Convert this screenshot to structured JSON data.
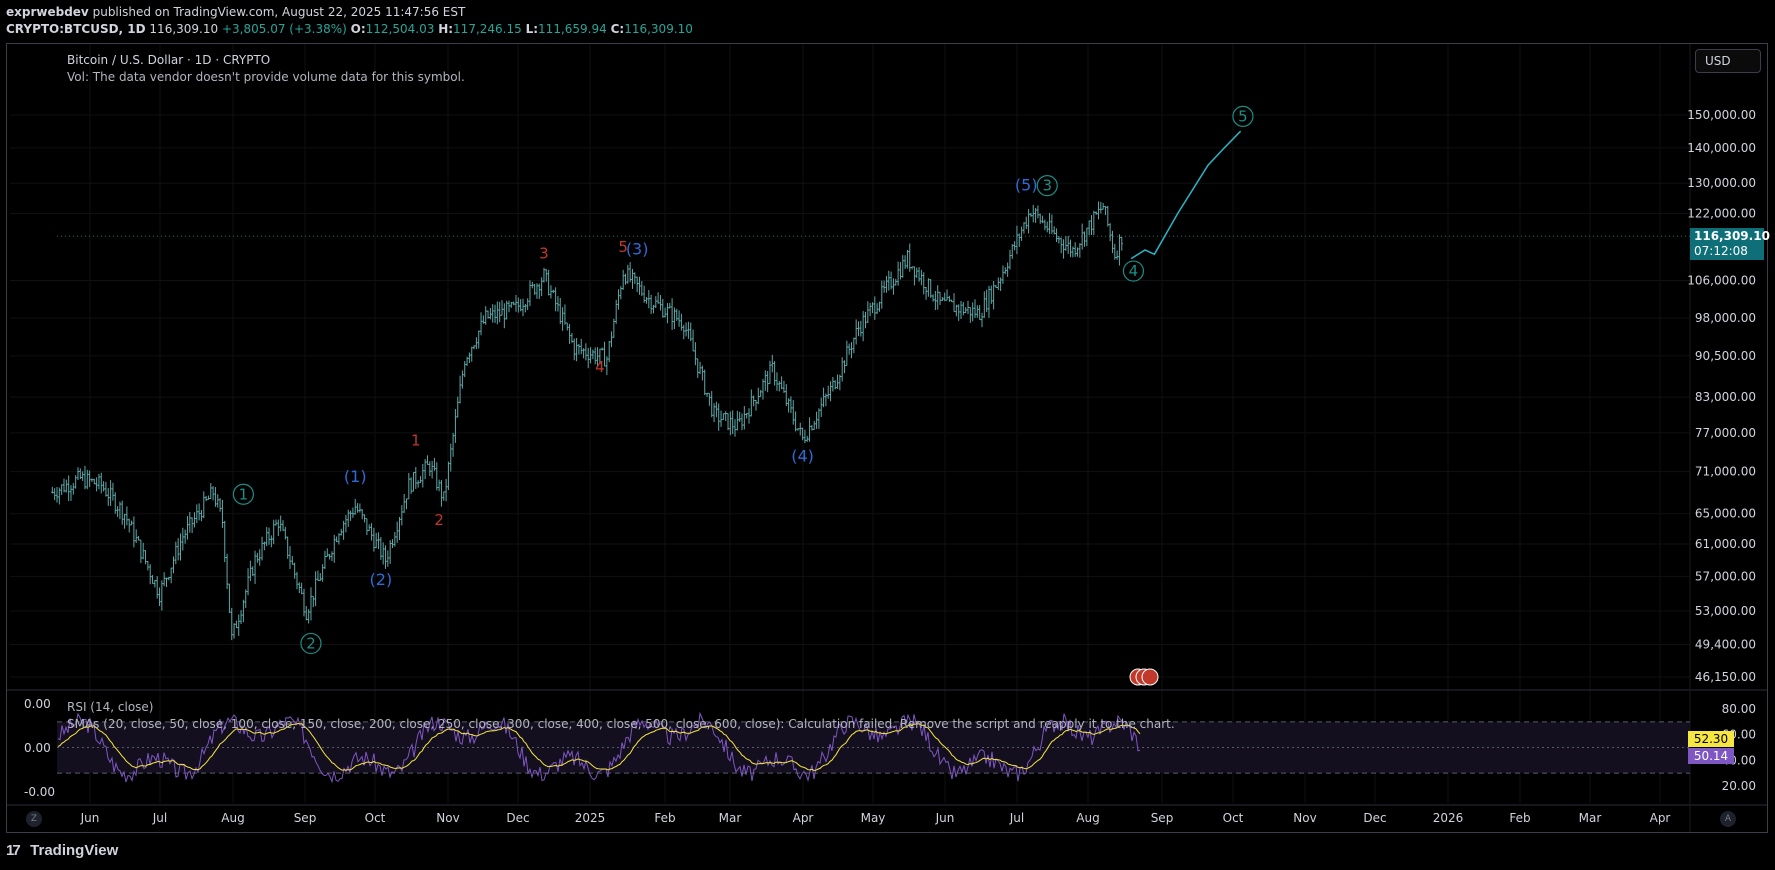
{
  "header": {
    "author": "exprwebdev",
    "published": "published on TradingView.com, August 22, 2025 11:47:56 EST",
    "symbol": "CRYPTO:BTCUSD, 1D",
    "last": "116,309.10",
    "change": "+3,805.07 (+3.38%)",
    "o_label": "O:",
    "o": "112,504.03",
    "h_label": "H:",
    "h": "117,246.15",
    "l_label": "L:",
    "l": "111,659.94",
    "c_label": "C:",
    "c": "116,309.10"
  },
  "legend": {
    "title": "Bitcoin / U.S. Dollar · 1D · CRYPTO",
    "vol": "Vol: The data vendor doesn't provide volume data for this symbol."
  },
  "currency_button": "USD",
  "price_tag": {
    "price": "116,309.10",
    "countdown": "07:12:08"
  },
  "rsi_legend": {
    "title": "RSI (14, close)",
    "smas": "SMAs (20, close, 50, close, 100, close, 150, close, 200, close, 250, close, 300, close, 400, close, 500, close, 600, close): Calculation failed. Remove the script and reapply it to the chart."
  },
  "rsi_tags": {
    "ma": "52.30",
    "rsi": "50.14"
  },
  "footer": {
    "brand": "TradingView",
    "logo": "17"
  },
  "corner_buttons": {
    "left": "Z",
    "right": "A"
  },
  "colors": {
    "candle": "#5fa8a8",
    "wave_red": "#c0392b",
    "wave_blue": "#2f6bd6",
    "wave_teal": "#1b8f86",
    "projection": "#29b6c9",
    "rsi_line": "#7e57c2",
    "rsi_ma": "#f5e642",
    "price_tag": "#0e6f78"
  },
  "chart_data": {
    "type": "candlestick",
    "title": "Bitcoin / U.S. Dollar · 1D · CRYPTO",
    "y_axis_ticks": [
      "150,000.00",
      "140,000.00",
      "130,000.00",
      "122,000.00",
      "106,000.00",
      "98,000.00",
      "90,500.00",
      "83,000.00",
      "77,000.00",
      "71,000.00",
      "65,000.00",
      "61,000.00",
      "57,000.00",
      "53,000.00",
      "49,400.00",
      "46,150.00"
    ],
    "x_axis_ticks": [
      "Jun",
      "Jul",
      "Aug",
      "Sep",
      "Oct",
      "Nov",
      "Dec",
      "2025",
      "Feb",
      "Mar",
      "Apr",
      "May",
      "Jun",
      "Jul",
      "Aug",
      "Sep",
      "Oct",
      "Nov",
      "Dec",
      "2026",
      "Feb",
      "Mar",
      "Apr"
    ],
    "log_scale": true,
    "last_price": 116309.1,
    "price_path": [
      [
        "2024-05-20",
        68000
      ],
      [
        "2024-06-01",
        70000
      ],
      [
        "2024-06-10",
        69000
      ],
      [
        "2024-06-20",
        65000
      ],
      [
        "2024-07-05",
        55000
      ],
      [
        "2024-07-15",
        62000
      ],
      [
        "2024-07-28",
        68000
      ],
      [
        "2024-08-01",
        64000
      ],
      [
        "2024-08-05",
        50000
      ],
      [
        "2024-08-15",
        59000
      ],
      [
        "2024-08-25",
        64000
      ],
      [
        "2024-09-06",
        53000
      ],
      [
        "2024-09-20",
        63000
      ],
      [
        "2024-09-27",
        66000
      ],
      [
        "2024-10-10",
        59000
      ],
      [
        "2024-10-20",
        69000
      ],
      [
        "2024-10-29",
        72000
      ],
      [
        "2024-11-04",
        67000
      ],
      [
        "2024-11-13",
        90000
      ],
      [
        "2024-11-22",
        98000
      ],
      [
        "2024-12-05",
        100000
      ],
      [
        "2024-12-17",
        107000
      ],
      [
        "2024-12-30",
        92000
      ],
      [
        "2025-01-13",
        90000
      ],
      [
        "2025-01-20",
        108000
      ],
      [
        "2025-01-31",
        102000
      ],
      [
        "2025-02-15",
        97000
      ],
      [
        "2025-02-28",
        80000
      ],
      [
        "2025-03-10",
        78000
      ],
      [
        "2025-03-25",
        88000
      ],
      [
        "2025-04-07",
        76000
      ],
      [
        "2025-04-20",
        85000
      ],
      [
        "2025-05-01",
        96000
      ],
      [
        "2025-05-22",
        111000
      ],
      [
        "2025-06-05",
        101000
      ],
      [
        "2025-06-22",
        99000
      ],
      [
        "2025-07-01",
        107000
      ],
      [
        "2025-07-14",
        123000
      ],
      [
        "2025-07-25",
        116000
      ],
      [
        "2025-08-01",
        113000
      ],
      [
        "2025-08-14",
        124000
      ],
      [
        "2025-08-19",
        112000
      ],
      [
        "2025-08-22",
        116309
      ]
    ],
    "projection_path": [
      [
        "2025-08-26",
        111000
      ],
      [
        "2025-09-01",
        113000
      ],
      [
        "2025-09-05",
        112000
      ],
      [
        "2025-09-15",
        122000
      ],
      [
        "2025-09-28",
        135000
      ],
      [
        "2025-10-05",
        140000
      ],
      [
        "2025-10-12",
        145000
      ]
    ],
    "wave_labels": [
      {
        "text": "1",
        "date": "2024-08-10",
        "price": 67000,
        "style": "teal-circle"
      },
      {
        "text": "2",
        "date": "2024-09-08",
        "price": 49000,
        "style": "teal-circle"
      },
      {
        "text": "(1)",
        "date": "2024-09-27",
        "price": 69500,
        "style": "blue"
      },
      {
        "text": "(2)",
        "date": "2024-10-08",
        "price": 56000,
        "style": "blue"
      },
      {
        "text": "1",
        "date": "2024-10-23",
        "price": 75000,
        "style": "red"
      },
      {
        "text": "2",
        "date": "2024-11-02",
        "price": 63500,
        "style": "red"
      },
      {
        "text": "3",
        "date": "2024-12-17",
        "price": 111000,
        "style": "red"
      },
      {
        "text": "4",
        "date": "2025-01-10",
        "price": 87500,
        "style": "red"
      },
      {
        "text": "5",
        "date": "2025-01-20",
        "price": 112500,
        "style": "red"
      },
      {
        "text": "(3)",
        "date": "2025-01-26",
        "price": 112000,
        "style": "blue"
      },
      {
        "text": "(4)",
        "date": "2025-04-07",
        "price": 72500,
        "style": "blue"
      },
      {
        "text": "(5)",
        "date": "2025-07-12",
        "price": 128000,
        "style": "blue"
      },
      {
        "text": "3",
        "date": "2025-07-21",
        "price": 128000,
        "style": "teal-circle"
      },
      {
        "text": "4",
        "date": "2025-08-27",
        "price": 107000,
        "style": "teal-circle"
      },
      {
        "text": "5",
        "date": "2025-10-13",
        "price": 148000,
        "style": "teal-circle"
      }
    ],
    "rsi": {
      "y_ticks": [
        "80.00",
        "60.00",
        "40.00",
        "20.00"
      ],
      "left_ticks": [
        "0.00",
        "0.00",
        "-0.00"
      ],
      "upper_band": 70,
      "lower_band": 30,
      "last_rsi": 50.14,
      "last_ma": 52.3
    }
  }
}
